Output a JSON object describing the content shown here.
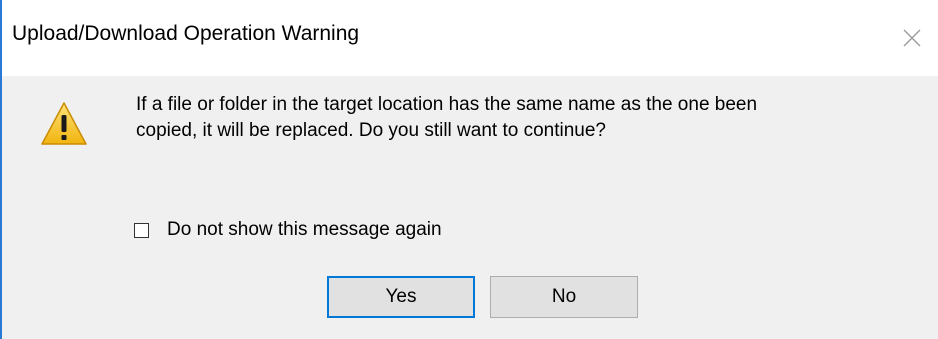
{
  "window": {
    "title": "Upload/Download Operation Warning",
    "close_icon": "close-icon"
  },
  "message": {
    "icon": "warning-icon",
    "lines": [
      "If a file or folder in the target location has the same name as the one been",
      "copied, it will be replaced. Do you still want to continue?"
    ]
  },
  "checkbox": {
    "label": "Do not show this message again",
    "checked": false
  },
  "buttons": {
    "yes_label": "Yes",
    "no_label": "No",
    "default": "Yes"
  },
  "colors": {
    "accent": "#0078d7",
    "window_border": "#2b78d6",
    "dialog_bg": "#f0f0f0",
    "warning_fill": "#f6c21c"
  }
}
